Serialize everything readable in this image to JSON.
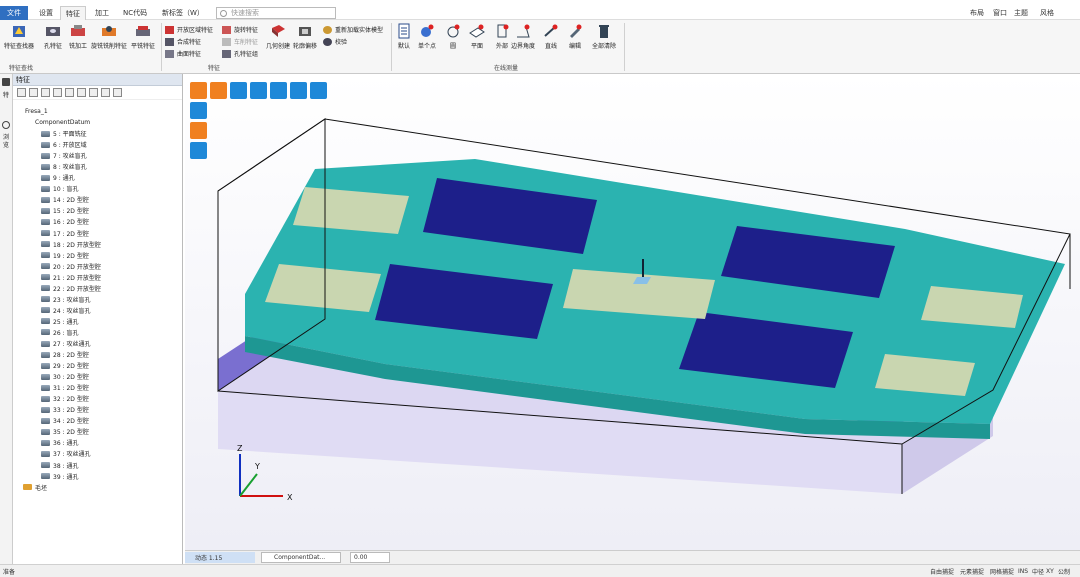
{
  "menu": {
    "file": "文件",
    "tabs": [
      "设置",
      "特征",
      "加工",
      "NC代码",
      "新标签（W）"
    ],
    "active_tab": "特征",
    "search_placeholder": "快速搜索",
    "right": {
      "layout": "布局",
      "window": "窗口",
      "theme": "主题",
      "style": "风格"
    }
  },
  "ribbon": {
    "buttons": {
      "feature_finder": "特征查找器",
      "hole_feature": "孔特征",
      "milling": "铣加工",
      "spiral_mill": "旋铣铣削特征",
      "planar_feature": "平铣特征"
    },
    "small": {
      "open_area": "开放区域特征",
      "synth": "合成特征",
      "curve": "曲面特征",
      "rotate": "旋转特征",
      "chamfer": "车削特征",
      "hole_group": "孔特征组",
      "geo_create": "几何创建",
      "contour_offset": "轮廓偏移",
      "update_model": "重新加载实体模型",
      "check": "校验"
    },
    "measure": {
      "default": "默认",
      "single_point": "单个点",
      "circle": "圆",
      "plane": "平面",
      "outer": "外部",
      "boundary": "边界角度",
      "line": "直线",
      "edit": "编辑",
      "delete_all": "全部清除"
    },
    "groups": {
      "finder": "特征查找",
      "feature": "特征",
      "measure": "在线测量"
    }
  },
  "panel": {
    "title": "特征",
    "tree": [
      "Fresa_1",
      "ComponentDatum",
      "5 : 平面铣征",
      "6 : 开放区域",
      "7 : 攻丝盲孔",
      "8 : 攻丝盲孔",
      "9 : 通孔",
      "10 : 盲孔",
      "14 : 2D 型腔",
      "15 : 2D 型腔",
      "16 : 2D 型腔",
      "17 : 2D 型腔",
      "18 : 2D 开放型腔",
      "19 : 2D 型腔",
      "20 : 2D 开放型腔",
      "21 : 2D 开放型腔",
      "22 : 2D 开放型腔",
      "23 : 攻丝盲孔",
      "24 : 攻丝盲孔",
      "25 : 通孔",
      "26 : 盲孔",
      "27 : 攻丝通孔",
      "28 : 2D 型腔",
      "29 : 2D 型腔",
      "30 : 2D 型腔",
      "31 : 2D 型腔",
      "32 : 2D 型腔",
      "33 : 2D 型腔",
      "34 : 2D 型腔",
      "35 : 2D 型腔",
      "36 : 通孔",
      "37 : 攻丝通孔",
      "38 : 通孔",
      "39 : 通孔",
      "毛坯"
    ],
    "left_strip": [
      "特",
      "征",
      "浏",
      "览"
    ]
  },
  "status": {
    "anim": "动态 1.15",
    "component": "ComponentDat...",
    "value": "0.00",
    "ready": "准备",
    "right_items": [
      "自由捕捉",
      "元素捕捉",
      "网格捕捉",
      "INS",
      "中径",
      "XY",
      "公制"
    ]
  },
  "axes": {
    "x": "X",
    "y": "Y",
    "z": "Z"
  },
  "colors": {
    "accent": "#2f6fc1",
    "plate": "#2bb3b0",
    "pocket": "#1d1f8a",
    "base": "#7a6fd0",
    "stock": "#dcd7f2"
  }
}
